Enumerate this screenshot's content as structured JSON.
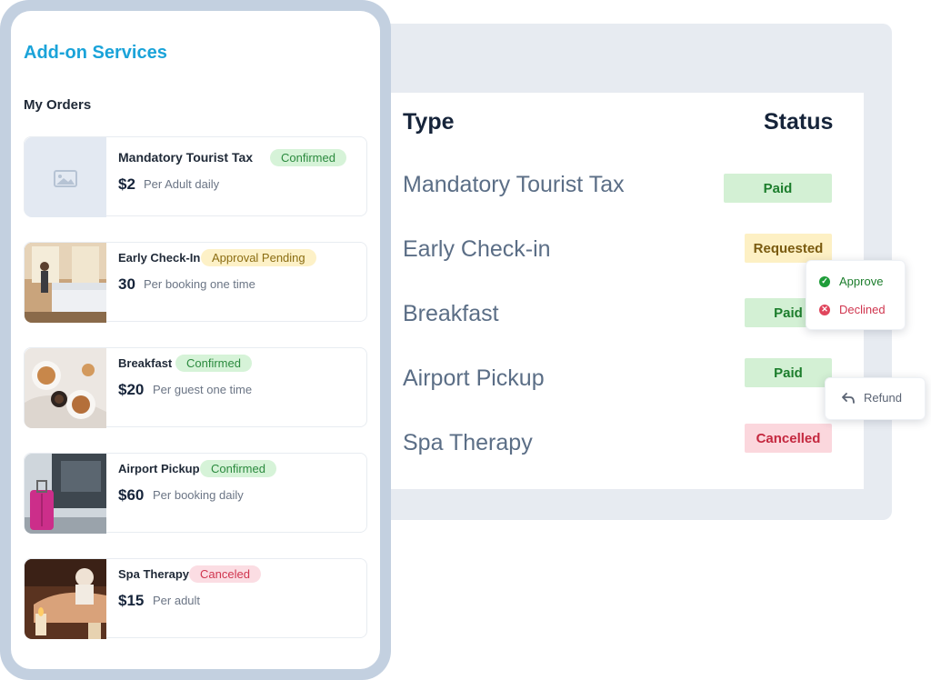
{
  "table": {
    "header_type": "Type",
    "header_status": "Status",
    "rows": [
      {
        "type": "Mandatory Tourist Tax",
        "status": "Paid"
      },
      {
        "type": "Early Check-in",
        "status": "Requested"
      },
      {
        "type": "Breakfast",
        "status": "Paid"
      },
      {
        "type": "Airport Pickup",
        "status": "Paid"
      },
      {
        "type": "Spa Therapy",
        "status": "Cancelled"
      }
    ]
  },
  "approval_popup": {
    "approve_label": "Approve",
    "decline_label": "Declined"
  },
  "refund_popup": {
    "refund_label": "Refund"
  },
  "app": {
    "title": "Add-on Services",
    "section_title": "My Orders"
  },
  "orders": [
    {
      "name": "Mandatory Tourist Tax",
      "status": "Confirmed",
      "price": "$2",
      "unit": "Per Adult daily",
      "thumb": "image-placeholder-icon"
    },
    {
      "name": "Early Check-In",
      "status": "Approval Pending",
      "price": "30",
      "unit": "Per booking one time",
      "thumb": "bedroom-photo"
    },
    {
      "name": "Breakfast",
      "status": "Confirmed",
      "price": "$20",
      "unit": "Per guest one time",
      "thumb": "breakfast-photo"
    },
    {
      "name": "Airport Pickup",
      "status": "Confirmed",
      "price": "$60",
      "unit": "Per booking daily",
      "thumb": "luggage-car-photo"
    },
    {
      "name": "Spa Therapy",
      "status": "Canceled",
      "price": "$15",
      "unit": "Per adult",
      "thumb": "spa-photo"
    }
  ],
  "colors": {
    "accent": "#1aa3d9",
    "paid_bg": "#d3f0d4",
    "requested_bg": "#fdf0c4",
    "cancelled_bg": "#fbd7dd",
    "phone_frame": "#c3d0e0"
  }
}
